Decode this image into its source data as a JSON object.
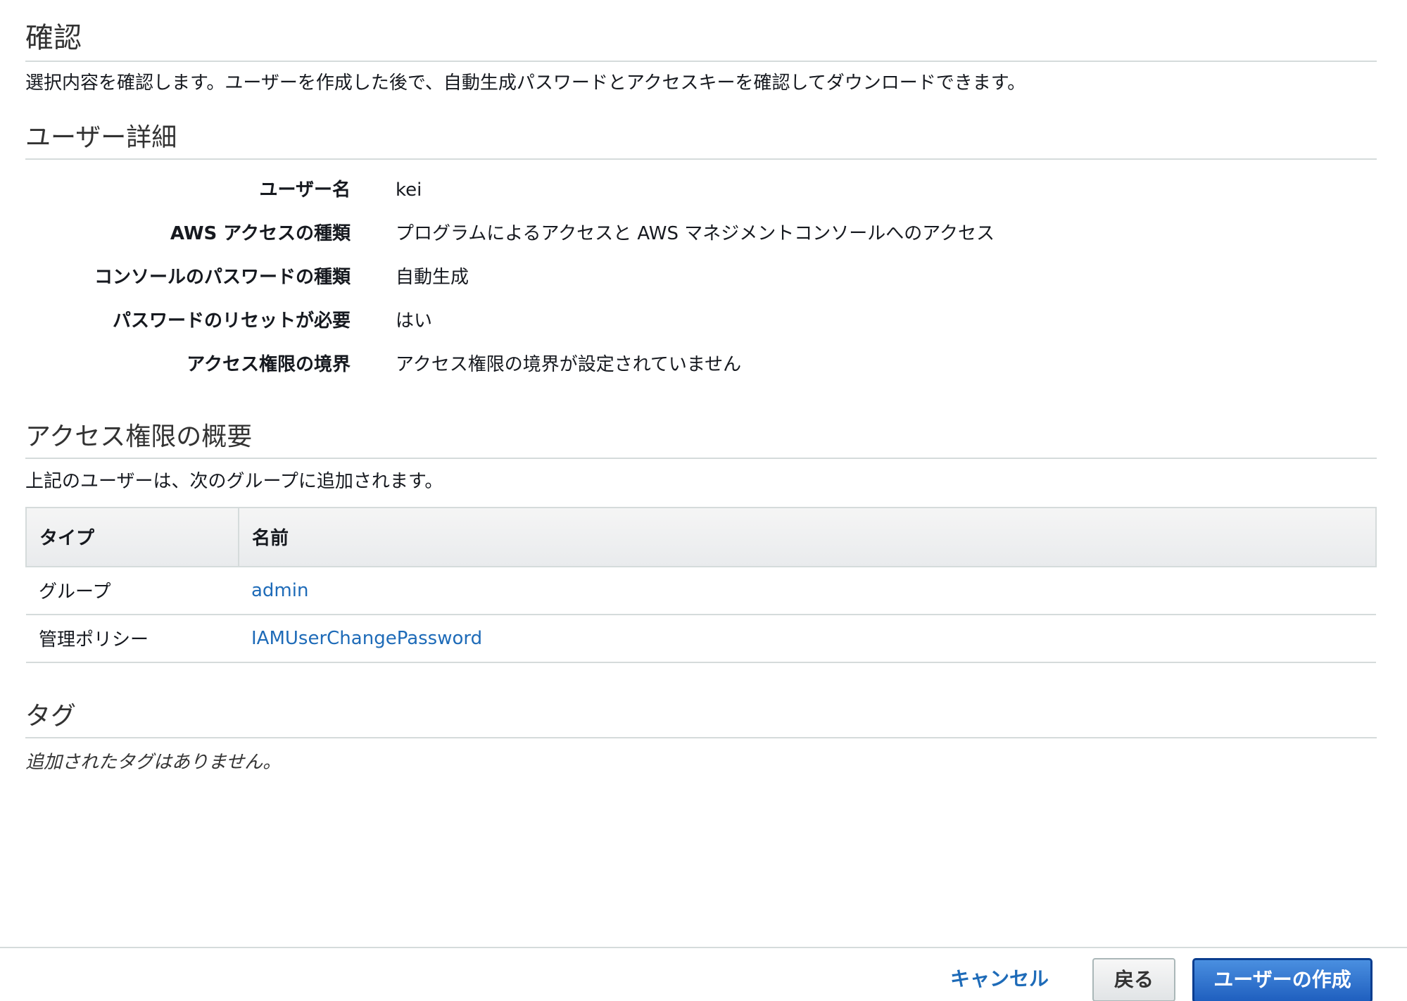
{
  "review": {
    "title": "確認",
    "description": "選択内容を確認します。ユーザーを作成した後で、自動生成パスワードとアクセスキーを確認してダウンロードできます。"
  },
  "user_details": {
    "title": "ユーザー詳細",
    "rows": [
      {
        "label": "ユーザー名",
        "value": "kei"
      },
      {
        "label": "AWS アクセスの種類",
        "value": "プログラムによるアクセスと AWS マネジメントコンソールへのアクセス"
      },
      {
        "label": "コンソールのパスワードの種類",
        "value": "自動生成"
      },
      {
        "label": "パスワードのリセットが必要",
        "value": "はい"
      },
      {
        "label": "アクセス権限の境界",
        "value": "アクセス権限の境界が設定されていません"
      }
    ]
  },
  "permissions": {
    "title": "アクセス権限の概要",
    "description": "上記のユーザーは、次のグループに追加されます。",
    "columns": [
      "タイプ",
      "名前"
    ],
    "rows": [
      {
        "type": "グループ",
        "name": "admin"
      },
      {
        "type": "管理ポリシー",
        "name": "IAMUserChangePassword"
      }
    ]
  },
  "tags": {
    "title": "タグ",
    "empty_text": "追加されたタグはありません。"
  },
  "footer": {
    "cancel_label": "キャンセル",
    "back_label": "戻る",
    "create_label": "ユーザーの作成"
  },
  "colors": {
    "link": "#1e6bb8",
    "primary_button": "#1f5fbf",
    "divider": "#d5dbdb"
  }
}
